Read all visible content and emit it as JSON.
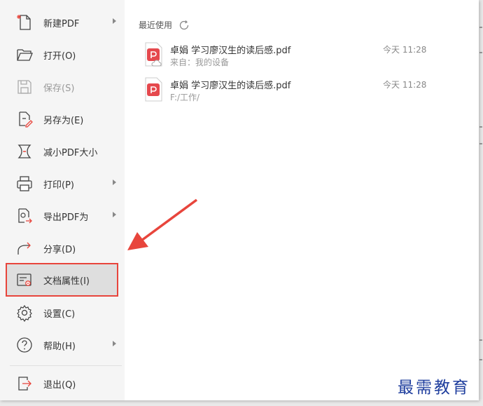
{
  "menu": {
    "items": [
      {
        "label": "新建PDF",
        "icon": "new-pdf-icon",
        "submenu": true
      },
      {
        "label": "打开(O)",
        "icon": "folder-open-icon",
        "submenu": false
      },
      {
        "label": "保存(S)",
        "icon": "save-icon",
        "submenu": false,
        "disabled": true
      },
      {
        "label": "另存为(E)",
        "icon": "save-as-icon",
        "submenu": false
      },
      {
        "label": "减小PDF大小",
        "icon": "compress-icon",
        "submenu": false
      },
      {
        "label": "打印(P)",
        "icon": "printer-icon",
        "submenu": true
      },
      {
        "label": "导出PDF为",
        "icon": "export-icon",
        "submenu": true
      },
      {
        "label": "分享(D)",
        "icon": "share-icon",
        "submenu": false
      },
      {
        "label": "文档属性(I)",
        "icon": "document-properties-icon",
        "submenu": false,
        "highlighted": true
      },
      {
        "label": "设置(C)",
        "icon": "gear-icon",
        "submenu": false
      },
      {
        "label": "帮助(H)",
        "icon": "help-icon",
        "submenu": true
      },
      {
        "label": "退出(Q)",
        "icon": "exit-icon",
        "submenu": false
      }
    ]
  },
  "recent": {
    "title": "最近使用",
    "files": [
      {
        "name": "卓娟 学习廖汉生的读后感.pdf",
        "location": "来自：我的设备",
        "time": "今天 11:28",
        "cloud": true
      },
      {
        "name": "卓娟 学习廖汉生的读后感.pdf",
        "location": "F:/工作/",
        "time": "今天 11:28",
        "cloud": false
      }
    ]
  },
  "colors": {
    "highlight_border": "#e8453c",
    "arrow": "#e8453c",
    "pdf_icon": "#e5484d",
    "watermark": "#1f3e9e"
  },
  "watermark": "最需教育"
}
